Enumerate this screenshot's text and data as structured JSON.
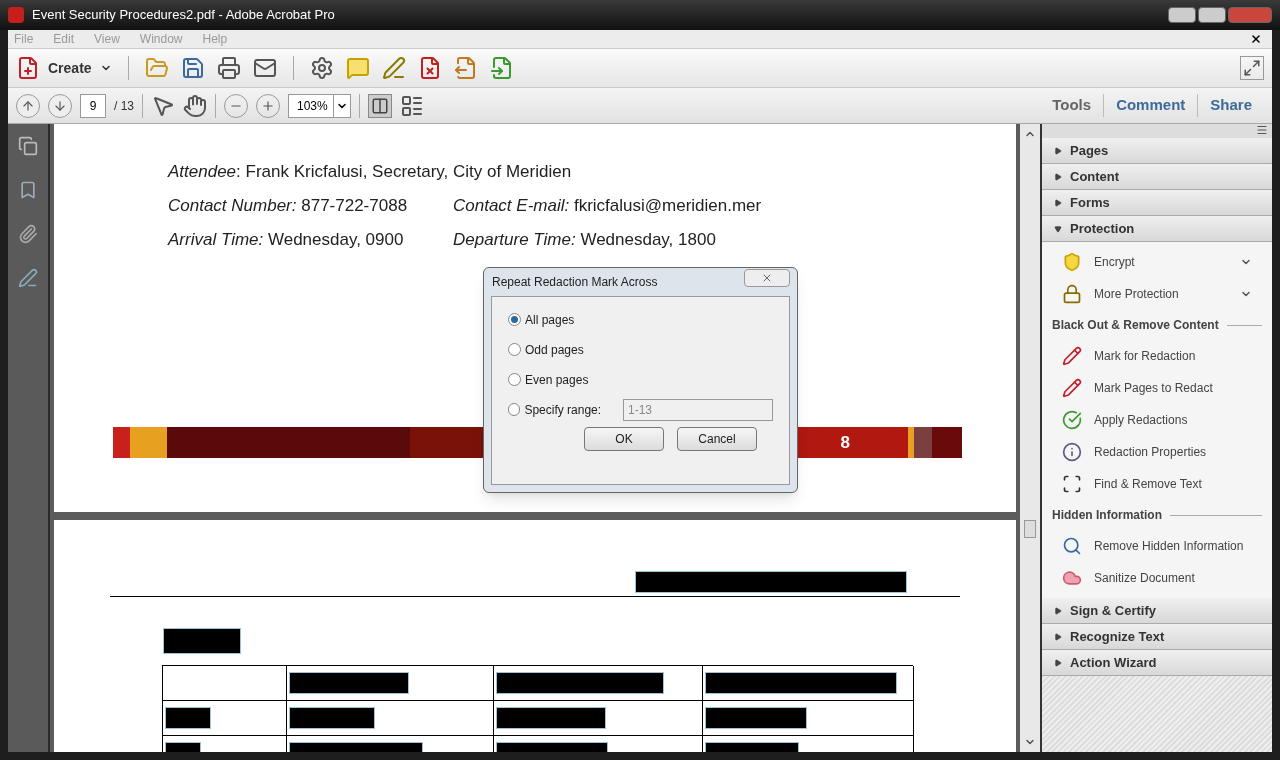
{
  "window": {
    "title": "Event Security Procedures2.pdf - Adobe Acrobat Pro"
  },
  "menu": [
    "File",
    "Edit",
    "View",
    "Window",
    "Help"
  ],
  "toolbar": {
    "create": "Create"
  },
  "navigation": {
    "page": "9",
    "total": "/ 13",
    "zoom": "103%"
  },
  "panes": [
    {
      "label": "Tools",
      "selected": true
    },
    {
      "label": "Comment",
      "selected": false
    },
    {
      "label": "Share",
      "selected": false
    }
  ],
  "document": {
    "lines": [
      [
        "*Attendee*: Frank Kricfalusi, Secretary, City of Meridien"
      ],
      [
        "*Contact Number:* 877-722-7088",
        "*Contact E-mail:* fkricfalusi@meridien.mer"
      ],
      [
        "*Arrival Time:* Wednesday, 0900",
        "*Departure Time:* Wednesday, 1800"
      ]
    ],
    "page_number": "8"
  },
  "dialog": {
    "title": "Repeat Redaction Mark Across",
    "options": [
      {
        "label": "All pages",
        "selected": true
      },
      {
        "label": "Odd pages",
        "selected": false
      },
      {
        "label": "Even pages",
        "selected": false
      },
      {
        "label": "Specify range:",
        "selected": false
      }
    ],
    "range": {
      "value": "1-13",
      "disabled": true
    },
    "buttons": [
      "OK",
      "Cancel"
    ]
  },
  "tools_panel": {
    "sections": [
      {
        "title": "Pages",
        "expanded": false
      },
      {
        "title": "Content",
        "expanded": false
      },
      {
        "title": "Forms",
        "expanded": false
      },
      {
        "title": "Protection",
        "expanded": true,
        "items": [
          {
            "kind": "dropdown",
            "label": "Encrypt"
          },
          {
            "kind": "dropdown",
            "label": "More Protection"
          },
          {
            "kind": "heading",
            "label": "Black Out & Remove Content"
          },
          {
            "kind": "tool",
            "label": "Mark for Redaction"
          },
          {
            "kind": "tool",
            "label": "Mark Pages to Redact"
          },
          {
            "kind": "tool",
            "label": "Apply Redactions"
          },
          {
            "kind": "tool",
            "label": "Redaction Properties"
          },
          {
            "kind": "tool",
            "label": "Find & Remove Text"
          },
          {
            "kind": "heading",
            "label": "Hidden Information"
          },
          {
            "kind": "tool",
            "label": "Remove Hidden Information"
          },
          {
            "kind": "tool",
            "label": "Sanitize Document"
          }
        ]
      },
      {
        "title": "Sign & Certify",
        "expanded": false
      },
      {
        "title": "Recognize Text",
        "expanded": false
      },
      {
        "title": "Action Wizard",
        "expanded": false
      }
    ]
  }
}
